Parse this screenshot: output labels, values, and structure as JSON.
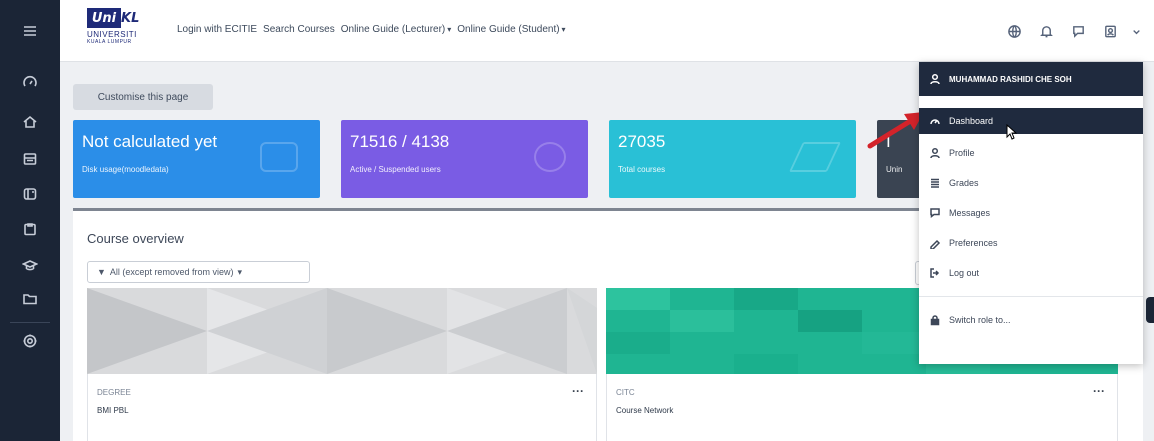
{
  "navbar": {
    "logo": {
      "uni": "Uni",
      "kl": "KL",
      "line1": "UNIVERSITI",
      "line2": "KUALA LUMPUR"
    },
    "links": [
      {
        "label": "Login with ECITIE",
        "dropdown": false
      },
      {
        "label": "Search Courses",
        "dropdown": false
      },
      {
        "label": "Online Guide (Lecturer)",
        "dropdown": true
      },
      {
        "label": "Online Guide (Student)",
        "dropdown": true
      }
    ],
    "icons": [
      "globe-icon",
      "bell-icon",
      "chat-icon",
      "user-avatar-icon",
      "chevron-down-icon"
    ]
  },
  "rail": {
    "items": [
      "menu-icon",
      "dashboard-icon",
      "home-icon",
      "calendar-icon",
      "courses-icon",
      "clipboard-icon",
      "graduation-icon",
      "folder-icon",
      "settings-icon"
    ]
  },
  "main": {
    "customise_label": "Customise this page",
    "cards": [
      {
        "value": "Not calculated yet",
        "label": "Disk usage(moodledata)",
        "color": "#2b8ee8"
      },
      {
        "value": "71516 / 4138",
        "label": "Active / Suspended users",
        "color": "#7a5ce4"
      },
      {
        "value": "27035",
        "label": "Total courses",
        "color": "#29c0d6"
      },
      {
        "value": "I",
        "label": "Unin",
        "color": "#3a4452"
      }
    ],
    "course_overview": {
      "title": "Course overview",
      "filter_label": "All (except removed from view)",
      "courses": [
        {
          "category": "DEGREE",
          "name": "BMI PBL"
        },
        {
          "category": "CITC",
          "name": "Course Network"
        }
      ]
    }
  },
  "user_menu": {
    "user_name": "MUHAMMAD RASHIDI CHE SOH",
    "items": [
      {
        "label": "Dashboard",
        "icon": "dashboard-icon",
        "active": true
      },
      {
        "label": "Profile",
        "icon": "profile-icon",
        "active": false
      },
      {
        "label": "Grades",
        "icon": "grades-icon",
        "active": false
      },
      {
        "label": "Messages",
        "icon": "messages-icon",
        "active": false
      },
      {
        "label": "Preferences",
        "icon": "preferences-icon",
        "active": false
      },
      {
        "label": "Log out",
        "icon": "logout-icon",
        "active": false
      }
    ],
    "switch_role": "Switch role to..."
  },
  "colors": {
    "rail": "#1b2536",
    "menu_active": "#1f2a3e",
    "arrow": "#d3232a"
  }
}
